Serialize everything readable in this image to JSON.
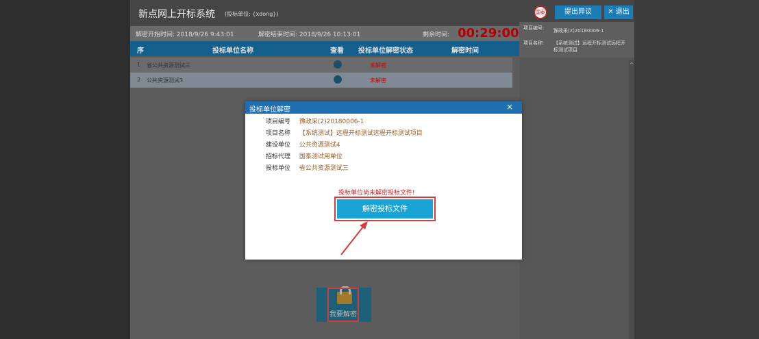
{
  "header": {
    "title": "新点网上开标系统",
    "bidder_label": "(投标单位: {xdong})",
    "logo_text": "国泰",
    "objection_btn": "提出异议",
    "exit_btn": "✕ 退出"
  },
  "timebar": {
    "start": "解密开始时间: 2018/9/26 9:43:01",
    "end": "解密结束时间: 2018/9/26 10:13:01",
    "remain_label": "剩余时间:",
    "countdown": "00:29:00"
  },
  "table": {
    "headers": [
      "序",
      "投标单位名称",
      "查看",
      "投标单位解密状态",
      "解密时间"
    ],
    "rows": [
      {
        "idx": "1",
        "name": "省公共资源测试三",
        "status": "未解密"
      },
      {
        "idx": "2",
        "name": "公共资源测试3",
        "status": "未解密"
      }
    ]
  },
  "right": {
    "code_label": "项目编号:",
    "code_value": "豫政采(2)20180006-1",
    "name_label": "项目名称:",
    "name_value": "【系统测试】远程开标测试远程开标测试项目"
  },
  "modal": {
    "title": "投标单位解密",
    "close": "×",
    "fields": [
      {
        "label": "项目编号",
        "value": "豫政采(2)20180006-1"
      },
      {
        "label": "项目名称",
        "value": "【系统测试】远程开标测试远程开标测试项目"
      },
      {
        "label": "建设单位",
        "value": "公共资源测试4"
      },
      {
        "label": "招标代理",
        "value": "国泰测试用单位"
      },
      {
        "label": "投标单位",
        "value": "省公共资源测试三"
      }
    ],
    "warning": "投标单位尚未解密投标文件!",
    "decrypt_btn": "解密投标文件"
  },
  "unlock": {
    "label": "我要解密"
  }
}
